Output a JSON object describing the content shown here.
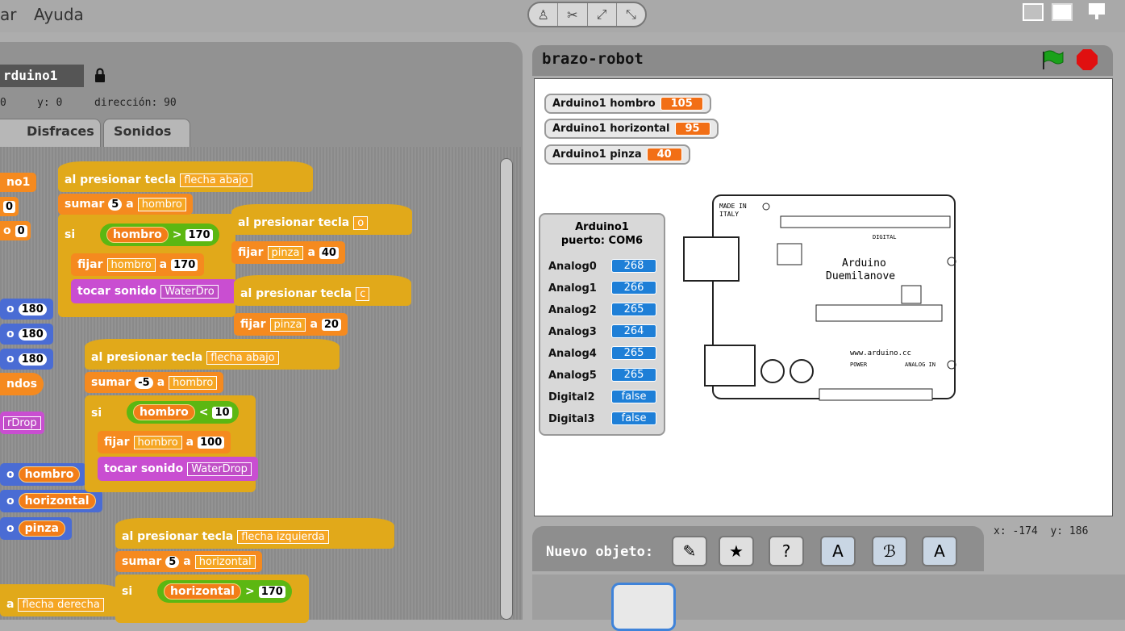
{
  "menu": {
    "item_partial": "ar",
    "help": "Ayuda"
  },
  "sprite": {
    "name": "rduino1",
    "x_label": "0",
    "y_label": "y: 0",
    "direction": "dirección: 90"
  },
  "tabs": {
    "costumes": "Disfraces",
    "sounds": "Sonidos"
  },
  "stage": {
    "title": "brazo-robot"
  },
  "left_fragments": {
    "a": "no1",
    "b": "0",
    "c": "0",
    "d1": "o",
    "d2": "o",
    "d3": "o",
    "v180": "180",
    "sounds": "ndos",
    "drop": "rDrop",
    "o": "o",
    "hombro": "hombro",
    "horizontal": "horizontal",
    "pinza": "pinza",
    "a_prefix": "a",
    "flecha_der": "flecha derecha"
  },
  "blocks": {
    "when_key": "al presionar tecla",
    "add": "sumar",
    "to": "a",
    "if": "si",
    "set": "fijar",
    "play_sound": "tocar sonido",
    "key_down": "flecha abajo",
    "key_o": "o",
    "key_c": "c",
    "key_left": "flecha izquierda",
    "var_hombro": "hombro",
    "var_pinza": "pinza",
    "var_horizontal": "horizontal",
    "gt": ">",
    "lt": "<",
    "n5": "5",
    "nm5": "-5",
    "n170": "170",
    "n40": "40",
    "n20": "20",
    "n10": "10",
    "n100": "100",
    "sound": "WaterDrop",
    "sound_partial": "WaterDro"
  },
  "monitors": [
    {
      "label": "Arduino1 hombro",
      "value": "105"
    },
    {
      "label": "Arduino1 horizontal",
      "value": "95"
    },
    {
      "label": "Arduino1 pinza",
      "value": "40"
    }
  ],
  "sensor": {
    "title1": "Arduino1",
    "title2": "puerto: COM6",
    "rows": [
      {
        "label": "Analog0",
        "value": "268"
      },
      {
        "label": "Analog1",
        "value": "266"
      },
      {
        "label": "Analog2",
        "value": "265"
      },
      {
        "label": "Analog3",
        "value": "264"
      },
      {
        "label": "Analog4",
        "value": "265"
      },
      {
        "label": "Analog5",
        "value": "265"
      },
      {
        "label": "Digital2",
        "value": "false"
      },
      {
        "label": "Digital3",
        "value": "false"
      }
    ]
  },
  "board": {
    "made": "MADE IN",
    "italy": "ITALY",
    "name1": "Arduino",
    "name2": "Duemilanove",
    "url": "www.arduino.cc",
    "digital": "DIGITAL",
    "power": "POWER",
    "analog": "ANALOG IN"
  },
  "readout": {
    "x": "x: -174",
    "y": "y: 186"
  },
  "new_object": {
    "label": "Nuevo objeto:"
  },
  "colors": {
    "stage_flag": "#1aa11a",
    "stop": "#e01010",
    "accent": "#3f83d9"
  }
}
